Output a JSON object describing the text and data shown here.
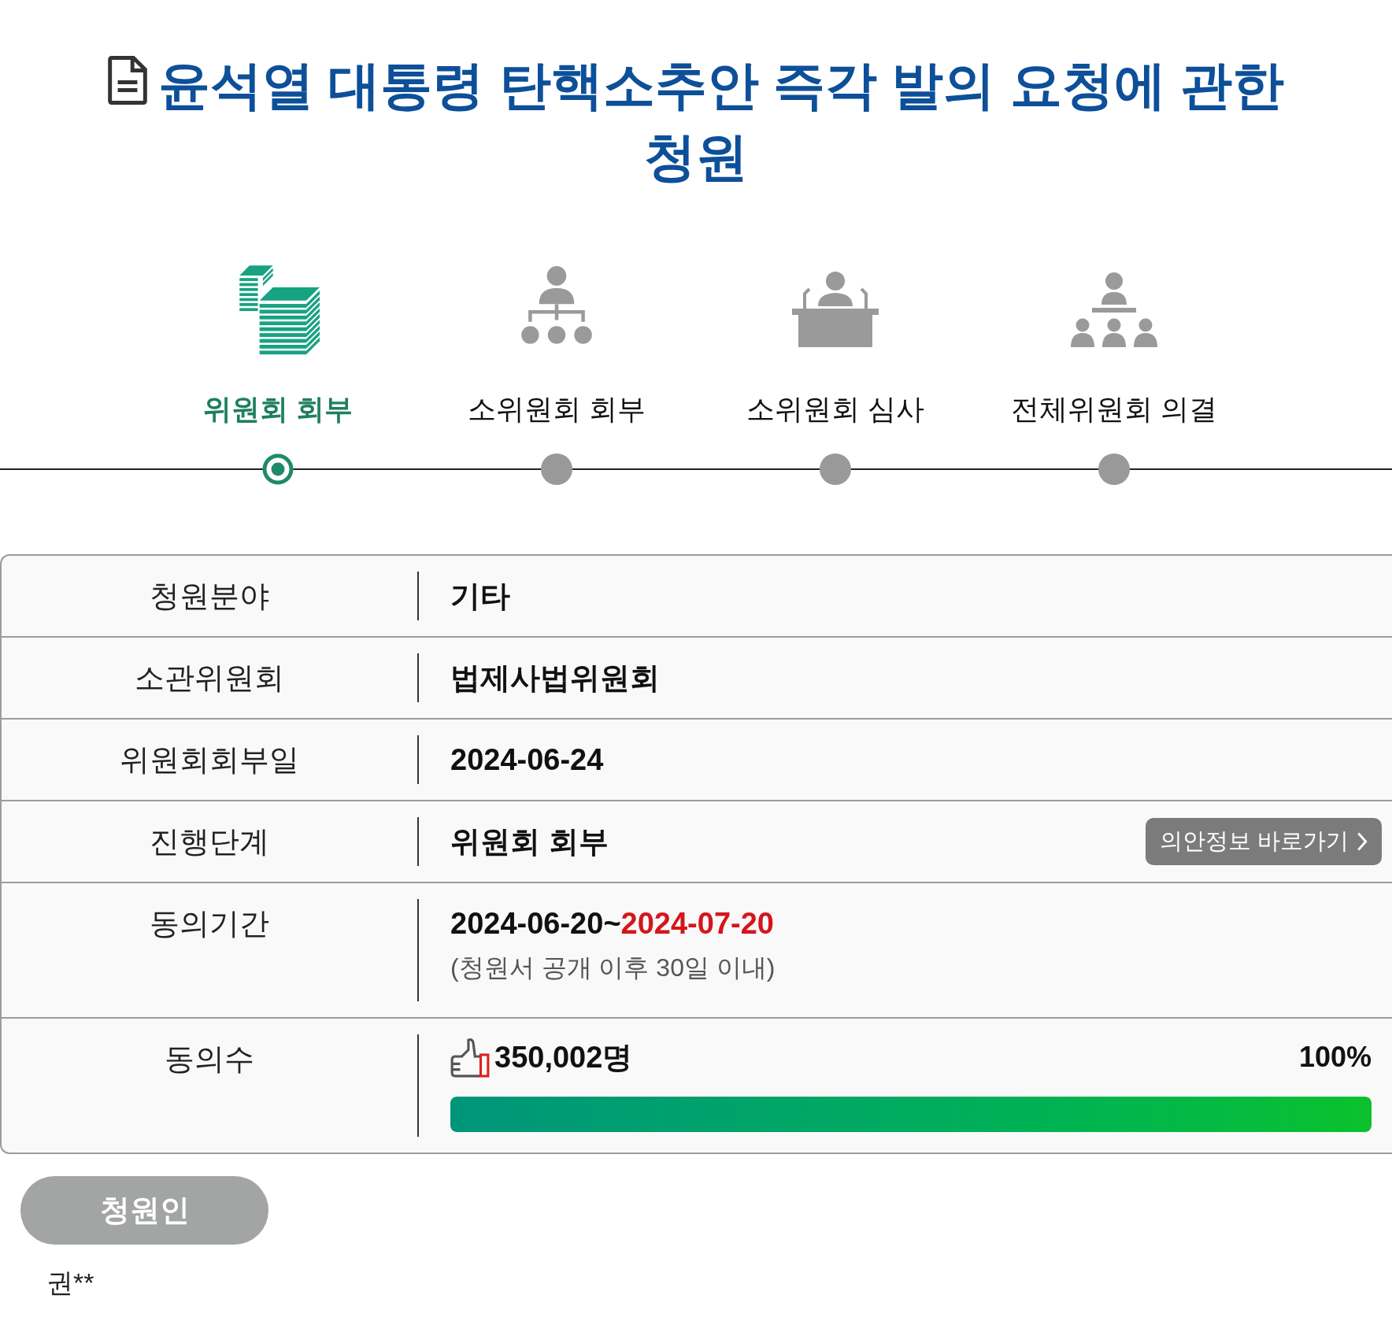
{
  "title": "윤석열 대통령 탄핵소추안 즉각 발의 요청에 관한 청원",
  "steps": [
    {
      "label": "위원회 회부",
      "selected": true
    },
    {
      "label": "소위원회 회부",
      "selected": false
    },
    {
      "label": "소위원회 심사",
      "selected": false
    },
    {
      "label": "전체위원회 의결",
      "selected": false
    }
  ],
  "details": [
    {
      "kind": "text",
      "label": "청원분야",
      "value": "기타"
    },
    {
      "kind": "text",
      "label": "소관위원회",
      "value": "법제사법위원회"
    },
    {
      "kind": "text",
      "label": "위원회회부일",
      "value": "2024-06-24"
    },
    {
      "kind": "link",
      "label": "진행단계",
      "value": "위원회 회부",
      "button": "의안정보 바로가기"
    },
    {
      "kind": "period",
      "label": "동의기간",
      "value": "2024-06-20~",
      "deadline": "2024-07-20",
      "note": "(청원서 공개 이후 30일 이내)"
    },
    {
      "kind": "progress",
      "label": "동의수",
      "value": "350,002명",
      "percent": "100%",
      "level": 1
    }
  ],
  "petitioner": {
    "heading": "청원인",
    "name": "권**"
  }
}
